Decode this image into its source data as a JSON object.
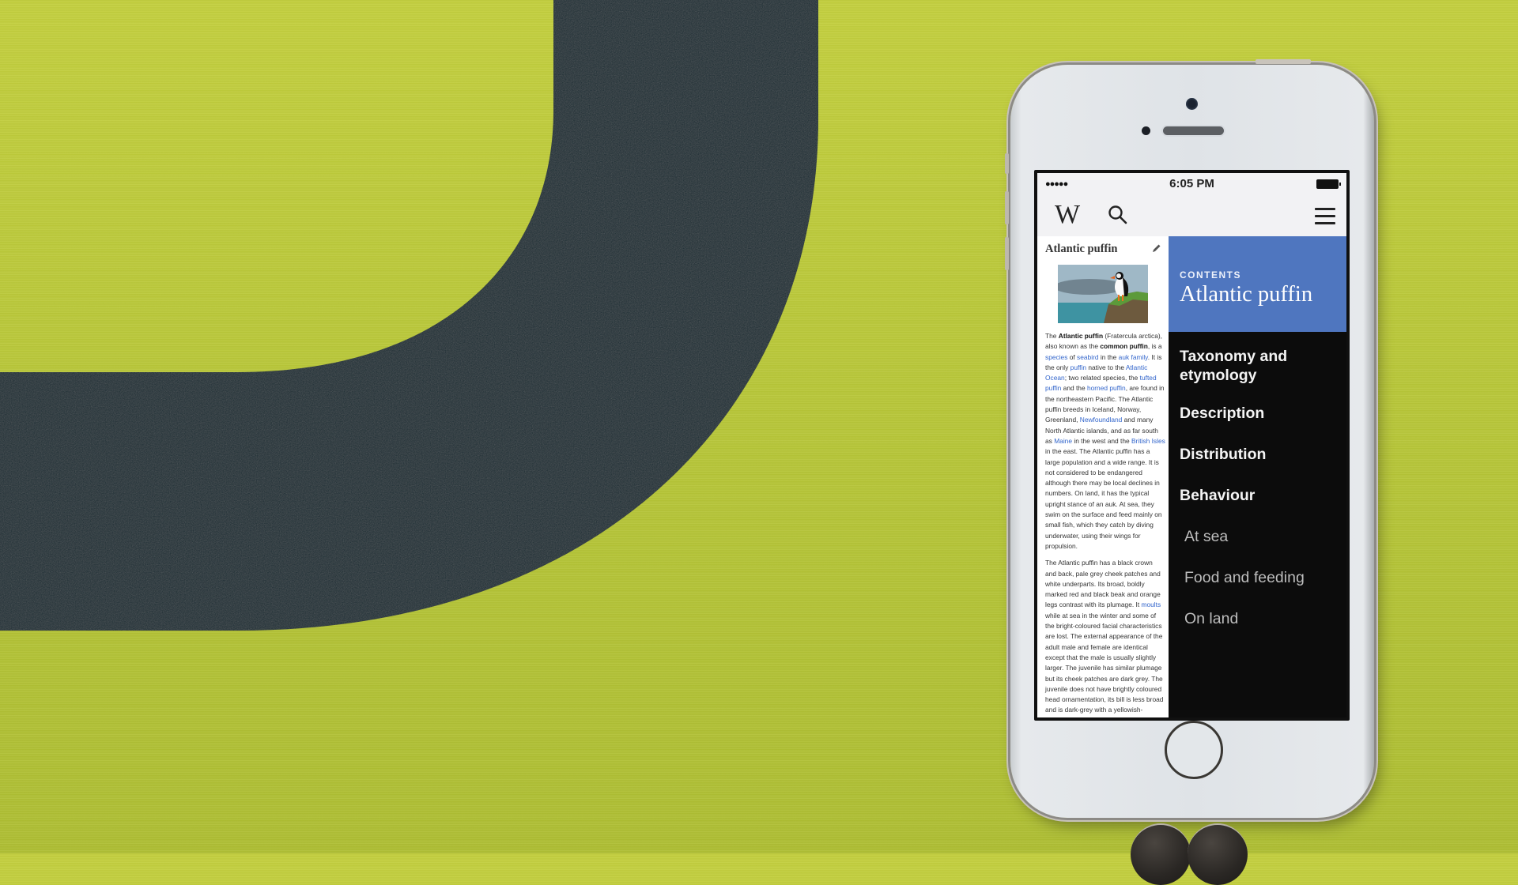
{
  "colors": {
    "background_lime": "#b9c83a",
    "background_band": "#1e2f36",
    "contents_header": "#4f76bf",
    "contents_bg": "#0c0c0c",
    "link": "#3366cc"
  },
  "statusbar": {
    "signal": "●●●●●",
    "time": "6:05 PM",
    "battery_icon": "battery-full-icon"
  },
  "navbar": {
    "logo": "W",
    "search_icon": "search-icon",
    "menu_icon": "hamburger-menu-icon"
  },
  "article": {
    "title": "Atlantic puffin",
    "edit_icon": "pencil-icon",
    "image_alt": "Atlantic puffin standing on grassy rock by the sea",
    "paragraphs": [
      [
        {
          "t": "The "
        },
        {
          "t": "Atlantic puffin",
          "b": true
        },
        {
          "t": " (Fratercula arctica), also known as the "
        },
        {
          "t": "common puffin",
          "b": true
        },
        {
          "t": ", is a "
        },
        {
          "t": "species",
          "link": true
        },
        {
          "t": " of "
        },
        {
          "t": "seabird",
          "link": true
        },
        {
          "t": " in the "
        },
        {
          "t": "auk family",
          "link": true
        },
        {
          "t": ". It is the only "
        },
        {
          "t": "puffin",
          "link": true
        },
        {
          "t": " native to the "
        },
        {
          "t": "Atlantic Ocean",
          "link": true
        },
        {
          "t": "; two related species, the "
        },
        {
          "t": "tufted puffin",
          "link": true
        },
        {
          "t": " and the "
        },
        {
          "t": "horned puffin",
          "link": true
        },
        {
          "t": ", are found in the northeastern Pacific. The Atlantic puffin breeds in Iceland, Norway, Greenland, "
        },
        {
          "t": "Newfoundland",
          "link": true
        },
        {
          "t": " and many North Atlantic islands, and as far south as "
        },
        {
          "t": "Maine",
          "link": true
        },
        {
          "t": " in the west and the "
        },
        {
          "t": "British Isles",
          "link": true
        },
        {
          "t": " in the east. The Atlantic puffin has a large population and a wide range. It is not considered to be endangered although there may be local declines in numbers. On land, it has the typical upright stance of an auk. At sea, they swim on the surface and feed mainly on small fish, which they catch by diving underwater, using their wings for propulsion."
        }
      ],
      [
        {
          "t": "The Atlantic puffin has a black crown and back, pale grey cheek patches and white underparts. Its broad, boldly marked red and black beak and orange legs contrast with its plumage. It "
        },
        {
          "t": "moults",
          "link": true
        },
        {
          "t": " while at sea in the winter and some of the bright-coloured facial characteristics are lost. The external appearance of the adult male and female are identical except that the male is usually slightly larger. The juvenile has similar plumage but its cheek patches are dark grey. The juvenile does not have brightly coloured head ornamentation, its bill is less broad and is dark-grey with a yellowish-"
        }
      ]
    ]
  },
  "contents": {
    "label": "CONTENTS",
    "title": "Atlantic puffin",
    "sections": [
      {
        "label": "Taxonomy and etymology",
        "level": 1
      },
      {
        "label": "Description",
        "level": 1
      },
      {
        "label": "Distribution",
        "level": 1
      },
      {
        "label": "Behaviour",
        "level": 1
      },
      {
        "label": "At sea",
        "level": 2
      },
      {
        "label": "Food and feeding",
        "level": 2
      },
      {
        "label": "On land",
        "level": 2
      }
    ]
  }
}
